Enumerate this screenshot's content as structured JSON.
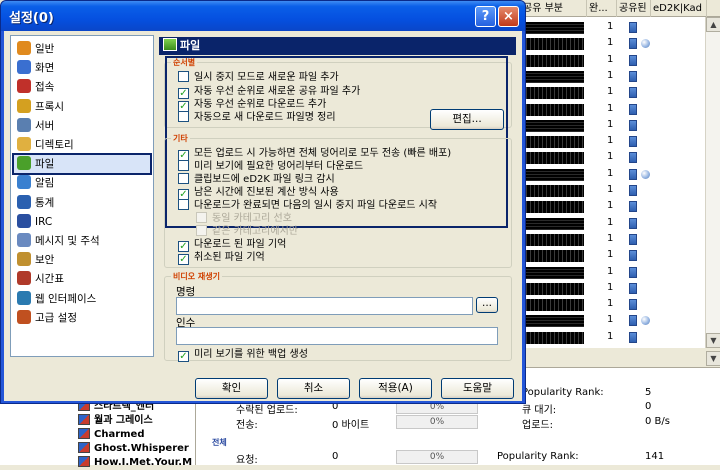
{
  "dialog": {
    "title": "설정(0)",
    "help_glyph": "?",
    "close_glyph": "×"
  },
  "nav": {
    "items": [
      {
        "label": "일반",
        "icon": "gear-icon",
        "color": "#e08a1e"
      },
      {
        "label": "화면",
        "icon": "monitor-icon",
        "color": "#3a6fd0"
      },
      {
        "label": "접속",
        "icon": "plug-icon",
        "color": "#c0302a"
      },
      {
        "label": "프록시",
        "icon": "proxy-icon",
        "color": "#d4a020"
      },
      {
        "label": "서버",
        "icon": "server-icon",
        "color": "#5a7fb0"
      },
      {
        "label": "디렉토리",
        "icon": "folder-icon",
        "color": "#e0b040"
      },
      {
        "label": "파일",
        "icon": "file-icon",
        "color": "#4aa02a"
      },
      {
        "label": "알림",
        "icon": "bell-icon",
        "color": "#3a80d0"
      },
      {
        "label": "통계",
        "icon": "stats-icon",
        "color": "#2a60b0"
      },
      {
        "label": "IRC",
        "icon": "irc-icon",
        "color": "#2a4fa0"
      },
      {
        "label": "메시지 및 주석",
        "icon": "message-icon",
        "color": "#6a8ac0"
      },
      {
        "label": "보안",
        "icon": "lock-icon",
        "color": "#c09030"
      },
      {
        "label": "시간표",
        "icon": "clock-icon",
        "color": "#b03a2a"
      },
      {
        "label": "웹 인터페이스",
        "icon": "globe-icon",
        "color": "#2a7ab0"
      },
      {
        "label": "고급 설정",
        "icon": "advanced-icon",
        "color": "#c05020"
      }
    ],
    "selected": "파일"
  },
  "panel": {
    "title": "파일",
    "group1_label": "순서별",
    "group1": [
      {
        "label": "일시 중지 모드로 새로운 파일 추가",
        "checked": false
      },
      {
        "label": "자동 우선 순위로 새로운 공유 파일 추가",
        "checked": true
      },
      {
        "label": "자동 우선 순위로 다운로드 추가",
        "checked": true
      },
      {
        "label": "자동으로 새 다운로드 파일명 정리",
        "checked": false
      }
    ],
    "edit_button": "편집...",
    "group2_label": "기타",
    "group2": [
      {
        "label": "모든 업로드 시 가능하면 전체 덩어리로 모두 전송 (빠른 배포)",
        "checked": true
      },
      {
        "label": "미리 보기에 필요한 덩어리부터 다운로드",
        "checked": false
      },
      {
        "label": "클립보드에 eD2K 파일 링크 감시",
        "checked": false
      },
      {
        "label": "남은 시간에 진보된 계산 방식 사용",
        "checked": true
      },
      {
        "label": "다운로드가 완료되면 다음의 일시 중지 파일 다운로드 시작",
        "checked": false
      }
    ],
    "disabled": [
      {
        "label": "동일 카테고리 선호",
        "checked": false
      },
      {
        "label": "같은 카테고리에서만",
        "checked": false
      }
    ],
    "extra": [
      {
        "label": "다운로드 된 파일 기억",
        "checked": true
      },
      {
        "label": "취소된 파일 기억",
        "checked": true
      }
    ],
    "group3_label": "비디오 재생기",
    "command_label": "명령",
    "command_value": "",
    "browse_button": "...",
    "args_label": "인수",
    "args_value": "",
    "backup_label": "미리 보기를 위한 백업 생성",
    "backup_checked": true
  },
  "buttons": {
    "ok": "확인",
    "cancel": "취소",
    "apply": "적용(A)",
    "help": "도움말"
  },
  "background": {
    "headers": [
      "공유 부분",
      "완...",
      "공유된",
      "eD2K|Kad"
    ],
    "row_counts": [
      "1",
      "1",
      "1",
      "1",
      "1",
      "1",
      "1",
      "1",
      "1",
      "1",
      "1",
      "1",
      "1",
      "1",
      "1",
      "1",
      "1",
      "1",
      "1",
      "1"
    ],
    "tree": [
      "스타트렉_엔터",
      "월과 그레이스",
      "Charmed",
      "Ghost.Whisperer",
      "How.I.Met.Your.M"
    ],
    "stats_upper": {
      "rank_label": "Popularity Rank:",
      "rank_value": "5",
      "row2_left": "수락된 업로드:",
      "row2_left_value": "0",
      "row2_pct": "0%",
      "row2_right": "큐 대기:",
      "row2_right_value": "0",
      "row3_left": "전송:",
      "row3_left_value": "0 바이트",
      "row3_pct": "0%",
      "row3_right": "업로드:",
      "row3_right_value": "0 B/s"
    },
    "stats_lower": {
      "group_label": "전체",
      "left": "요청:",
      "left_value": "0",
      "pct": "0%",
      "rank_label": "Popularity Rank:",
      "rank_value": "141"
    }
  }
}
